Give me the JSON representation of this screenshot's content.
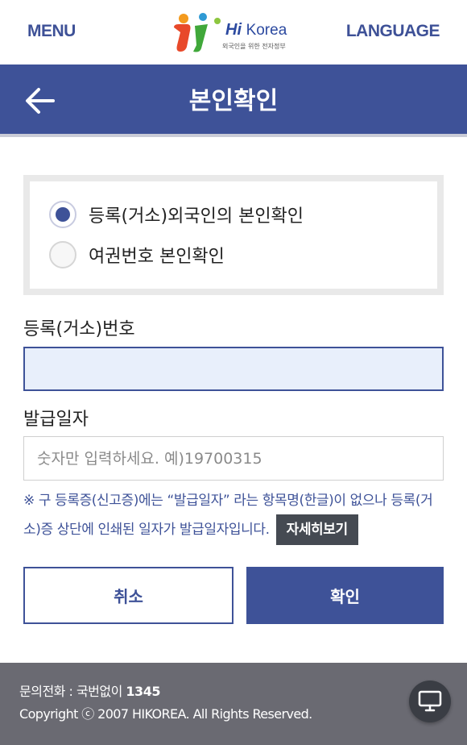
{
  "header": {
    "menu_label": "MENU",
    "language_label": "LANGUAGE",
    "logo_brand": "Hi",
    "logo_country": "Korea",
    "logo_subtitle": "외국인을 위한 전자정부"
  },
  "titlebar": {
    "title": "본인확인"
  },
  "verification_options": [
    {
      "label": "등록(거소)외국인의 본인확인",
      "selected": true
    },
    {
      "label": "여권번호 본인확인",
      "selected": false
    }
  ],
  "form": {
    "reg_number_label": "등록(거소)번호",
    "reg_number_value": "",
    "issue_date_label": "발급일자",
    "issue_date_placeholder": "숫자만 입력하세요. 예)19700315",
    "notice": "※ 구 등록증(신고증)에는 “발급일자” 라는 항목명(한글)이 없으나 등록(거소)증 상단에 인쇄된 일자가 발급일자입니다.",
    "detail_button": "자세히보기"
  },
  "actions": {
    "cancel": "취소",
    "confirm": "확인"
  },
  "footer": {
    "phone_label": "문의전화 : 국번없이 ",
    "phone_number": "1345",
    "copyright": "Copyright ⓒ 2007 HIKOREA. All Rights Reserved."
  },
  "colors": {
    "primary": "#3e5298",
    "footer_bg": "#6a6a72",
    "input_active_bg": "#e8effb"
  }
}
